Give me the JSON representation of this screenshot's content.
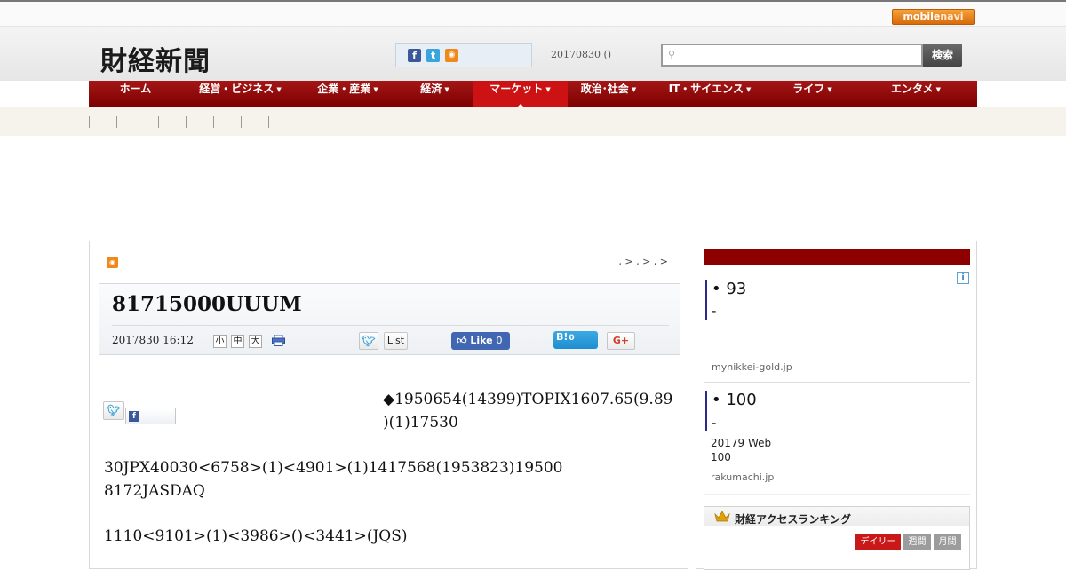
{
  "topbar": {
    "mobilenavi_mobile": "mobile",
    "mobilenavi_navi": "navi"
  },
  "header": {
    "logo": "財経新聞",
    "date": "20170830 ()",
    "search_button": "検索",
    "search_placeholder": "",
    "social_icons": [
      "facebook-icon",
      "twitter-icon",
      "rss-icon"
    ]
  },
  "nav": {
    "items": [
      {
        "label": "ホーム",
        "dropdown": false
      },
      {
        "label": "経営・ビジネス",
        "dropdown": true
      },
      {
        "label": "企業・産業",
        "dropdown": true
      },
      {
        "label": "経済",
        "dropdown": true
      },
      {
        "label": "マーケット",
        "dropdown": true,
        "active": true
      },
      {
        "label": "政治･社会",
        "dropdown": true
      },
      {
        "label": "IT・サイエンス",
        "dropdown": true
      },
      {
        "label": "ライフ",
        "dropdown": true
      },
      {
        "label": "エンタメ",
        "dropdown": true
      }
    ],
    "caret": "▼"
  },
  "article": {
    "breadcrumb": ", > , > , >",
    "title": "81715000UUUM",
    "date": "2017830 16:12",
    "font_sizes": [
      "小",
      "中",
      "大"
    ],
    "list_label": "List",
    "like_label": "Like",
    "like_count": "0",
    "hatena_label": "B!",
    "hatena_count": "0",
    "gplus_label": "G+",
    "paragraphs": {
      "p1": "◆1950654(14399)TOPIX1607.65(9.89",
      "p1b": ")(1)17530",
      "p2": "30JPX40030<6758>(1)<4901>(1)1417568(1953823)19500",
      "p2b": "8172JASDAQ",
      "p3": "1110<9101>(1)<3986>()<3441>(JQS)"
    }
  },
  "sidebar": {
    "ads": [
      {
        "headline": "• 93",
        "dash": "-",
        "desc1": "",
        "desc2": "",
        "source": "mynikkei-gold.jp"
      },
      {
        "headline": "• 100",
        "dash": "-",
        "desc1": "20179 Web",
        "desc2": "100",
        "source": "rakumachi.jp"
      }
    ],
    "adchoices": "i",
    "ranking": {
      "title": "財経アクセスランキング",
      "tabs": [
        "デイリー",
        "週間",
        "月間"
      ]
    }
  }
}
